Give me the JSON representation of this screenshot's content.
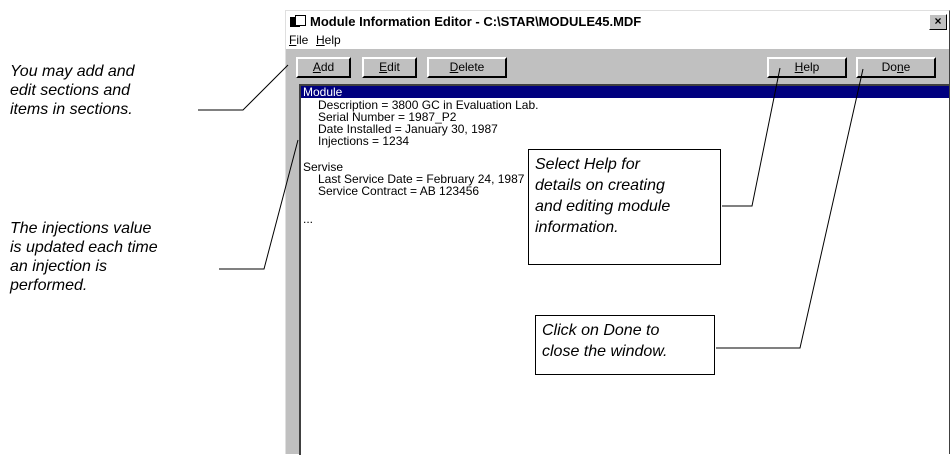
{
  "left_annotations": [
    {
      "lines": [
        "You may add and",
        "edit sections and",
        "items in sections."
      ]
    },
    {
      "lines": [
        "The injections value",
        "is updated each time",
        "an injection is",
        "performed."
      ]
    }
  ],
  "window": {
    "title": "Module Information Editor - C:\\STAR\\MODULE45.MDF",
    "close_glyph": "×",
    "menu": [
      {
        "mnemonic": "F",
        "rest": "ile"
      },
      {
        "mnemonic": "H",
        "rest": "elp"
      }
    ],
    "buttons": {
      "add": {
        "mnemonic": "A",
        "rest": "dd"
      },
      "edit": {
        "mnemonic": "E",
        "rest": "dit"
      },
      "delete": {
        "mnemonic": "D",
        "rest": "elete"
      },
      "help": {
        "mnemonic": "H",
        "rest": "elp"
      },
      "done_prefix": "Do",
      "done_mnemonic": "n",
      "done_suffix": "e"
    },
    "content_lines": [
      "Module",
      "Description = 3800 GC in Evaluation Lab.",
      "Serial Number = 1987_P2",
      "Date Installed = January 30, 1987",
      "Injections = 1234",
      "Servise",
      "Last Service Date = February 24, 1987",
      "Service Contract = AB 123456",
      "..."
    ]
  },
  "callouts": [
    {
      "lines": [
        "Select Help for",
        "details on creating",
        "and editing module",
        "information."
      ]
    },
    {
      "lines": [
        "Click on Done to",
        "close the window."
      ]
    }
  ],
  "colors": {
    "selection": "#00007f",
    "window_face": "#c0c0c0"
  }
}
